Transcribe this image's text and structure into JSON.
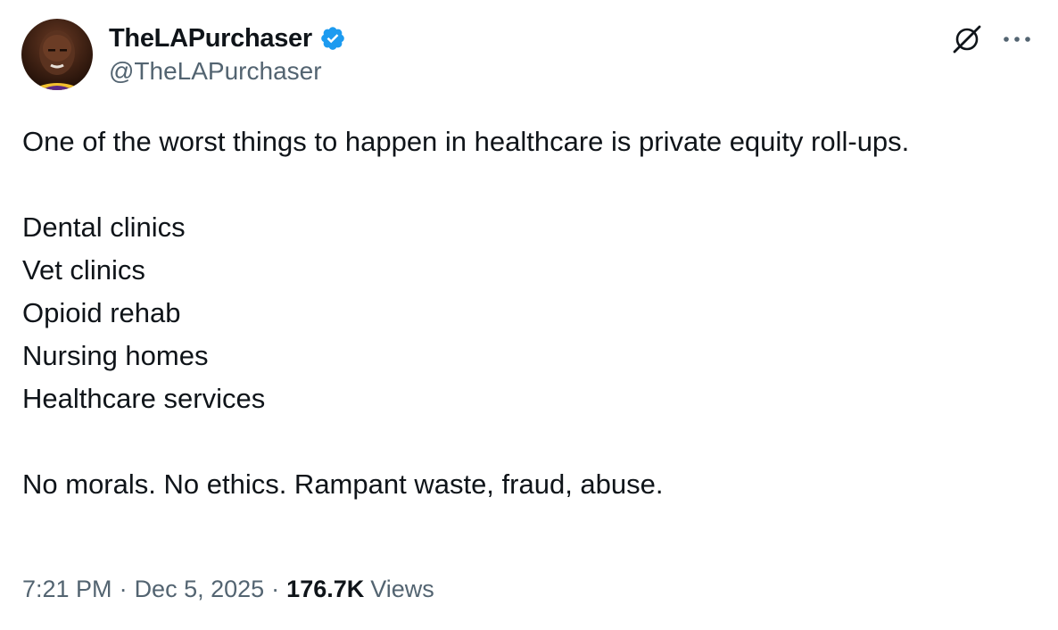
{
  "author": {
    "display_name": "TheLAPurchaser",
    "handle": "@TheLAPurchaser",
    "verified": true
  },
  "icons": {
    "verified": "verified-badge-icon",
    "grok": "grok-icon",
    "more": "more-options-icon"
  },
  "colors": {
    "verified_blue": "#1d9bf0",
    "secondary_text": "#536471",
    "primary_text": "#0f1419"
  },
  "tweet": {
    "intro": "One of the worst things to happen in healthcare is private equity roll-ups.",
    "list": [
      "Dental clinics",
      "Vet clinics",
      "Opioid rehab",
      "Nursing homes",
      "Healthcare services"
    ],
    "closing": "No morals. No ethics. Rampant waste, fraud, abuse."
  },
  "meta": {
    "time": "7:21 PM",
    "separator": "·",
    "date": "Dec 5, 2025",
    "views_count": "176.7K",
    "views_label": "Views"
  }
}
